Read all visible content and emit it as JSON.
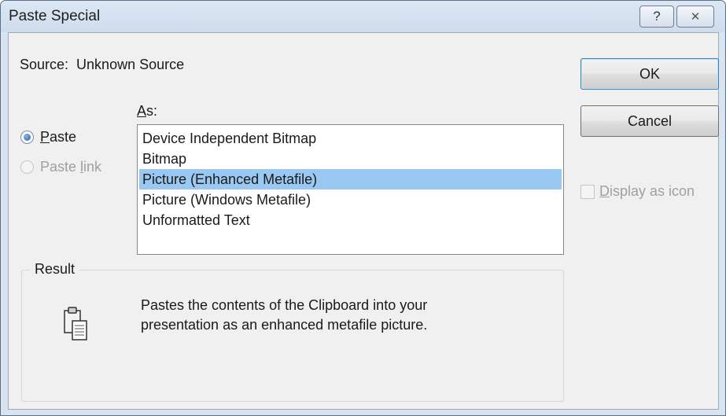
{
  "window": {
    "title": "Paste Special",
    "help_glyph": "?",
    "close_glyph": "✕"
  },
  "source": {
    "label": "Source:",
    "value": "Unknown Source"
  },
  "as_label": {
    "mnemonic": "A",
    "rest": "s:"
  },
  "options": {
    "paste": {
      "mnemonic": "P",
      "rest": "aste",
      "checked": true
    },
    "paste_link": {
      "before": "Paste ",
      "mnemonic": "l",
      "rest": "ink",
      "enabled": false
    }
  },
  "list": {
    "items": [
      "Device Independent Bitmap",
      "Bitmap",
      "Picture (Enhanced Metafile)",
      "Picture (Windows Metafile)",
      "Unformatted Text"
    ],
    "selected_index": 2
  },
  "buttons": {
    "ok": "OK",
    "cancel": "Cancel"
  },
  "display_as_icon": {
    "mnemonic": "D",
    "rest": "isplay as icon",
    "checked": false,
    "enabled": false
  },
  "result": {
    "label": "Result",
    "line1": "Pastes the contents of the Clipboard into your",
    "line2": "presentation as an enhanced metafile picture."
  },
  "colors": {
    "selection": "#99c9f2",
    "title_bar": "#d5e1ef",
    "client": "#f0f0f0"
  },
  "icons": {
    "result_icon": "clipboard-paste-icon"
  }
}
